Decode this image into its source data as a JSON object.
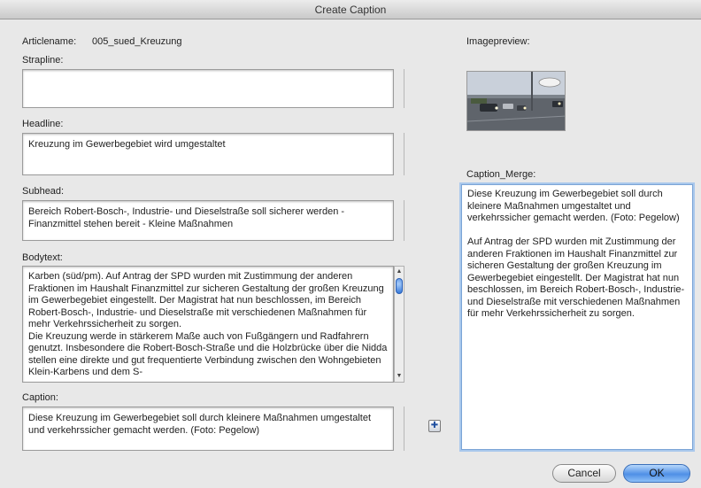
{
  "window": {
    "title": "Create Caption"
  },
  "article": {
    "label": "Articlename:",
    "value": "005_sued_Kreuzung"
  },
  "strapline": {
    "label": "Strapline:",
    "value": ""
  },
  "headline": {
    "label": "Headline:",
    "value": "Kreuzung im Gewerbegebiet wird umgestaltet"
  },
  "subhead": {
    "label": "Subhead:",
    "value": "Bereich Robert-Bosch-, Industrie- und Dieselstraße soll sicherer werden - Finanzmittel stehen bereit - Kleine Maßnahmen"
  },
  "bodytext": {
    "label": "Bodytext:",
    "value": "Karben (süd/pm). Auf Antrag der SPD wurden mit Zustimmung der anderen Fraktionen im Haushalt Finanzmittel zur sicheren Gestaltung der großen Kreuzung im Gewerbegebiet eingestellt. Der Magistrat hat nun beschlossen, im Bereich Robert-Bosch-, Industrie- und Dieselstraße mit verschiedenen Maßnahmen für mehr Verkehrssicherheit zu sorgen.\nDie Kreuzung werde in stärkerem Maße auch von Fußgängern und Radfahrern genutzt. Insbesondere die Robert-Bosch-Straße und die Holzbrücke über die Nidda stellen eine direkte und gut frequentierte Verbindung zwischen den Wohngebieten Klein-Karbens und dem S-"
  },
  "caption": {
    "label": "Caption:",
    "value": "Diese Kreuzung im Gewerbegebiet soll durch kleinere Maßnahmen umgestaltet und verkehrssicher gemacht werden. (Foto: Pegelow)"
  },
  "imagepreview": {
    "label": "Imagepreview:"
  },
  "caption_merge": {
    "label": "Caption_Merge:",
    "value": "Diese Kreuzung im Gewerbegebiet soll durch kleinere Maßnahmen umgestaltet und verkehrssicher gemacht werden. (Foto: Pegelow)\n\nAuf Antrag der SPD wurden mit Zustimmung der anderen Fraktionen im Haushalt Finanzmittel zur sicheren Gestaltung der großen Kreuzung im Gewerbegebiet eingestellt. Der Magistrat hat nun beschlossen, im Bereich Robert-Bosch-, Industrie- und Dieselstraße mit verschiedenen Maßnahmen für mehr Verkehrssicherheit zu sorgen."
  },
  "buttons": {
    "cancel": "Cancel",
    "ok": "OK"
  },
  "icons": {
    "merge_button": "plus-icon",
    "scroll_up": "arrow-up-icon",
    "scroll_down": "arrow-down-icon"
  },
  "colors": {
    "ok_button": "#4f8fe6",
    "focus_ring": "#a9c8ec"
  }
}
